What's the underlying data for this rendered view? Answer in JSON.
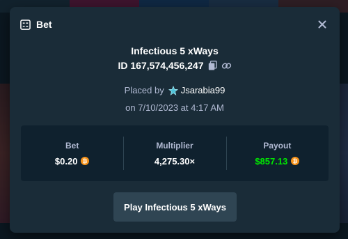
{
  "background": {
    "tile_colors": [
      "#2a4a5c",
      "#c2185b",
      "#1f5fa8",
      "#3d6da3",
      "#8c3a3a"
    ]
  },
  "modal": {
    "title": "Bet",
    "header_icon": "receipt-icon",
    "close_icon": "close-icon"
  },
  "bet": {
    "game_name": "Infectious 5 xWays",
    "id_text": "ID 167,574,456,247",
    "placed_by_label": "Placed by",
    "username": "Jsarabia99",
    "date_text": "on 7/10/2023 at 4:17 AM"
  },
  "stats": {
    "bet_label": "Bet",
    "bet_value": "$0.20",
    "multiplier_label": "Multiplier",
    "multiplier_value": "4,275.30×",
    "payout_label": "Payout",
    "payout_value": "$857.13"
  },
  "actions": {
    "play_label": "Play Infectious 5 xWays"
  },
  "colors": {
    "modal_bg": "#1a2c38",
    "panel_bg": "#0f212e",
    "button_bg": "#2f4553",
    "muted_text": "#b1bad3",
    "payout_green": "#00e701",
    "coin_orange": "#f7931a"
  }
}
